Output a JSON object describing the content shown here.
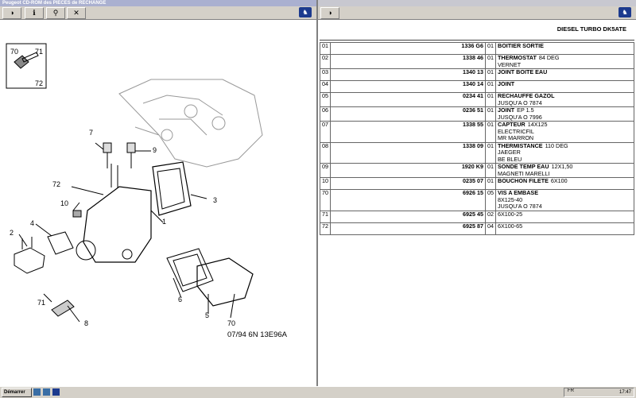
{
  "window": {
    "title": "Peugeot CD-ROM des PIECES de RECHANGE"
  },
  "left_toolbar": {
    "buttons": [
      "◑",
      "ℹ",
      "⚲",
      "✕"
    ]
  },
  "right_toolbar": {
    "buttons": [
      "◑"
    ]
  },
  "diagram": {
    "ref_labels": [
      "70",
      "71",
      "72",
      "7",
      "9",
      "72",
      "10",
      "3",
      "4",
      "1",
      "2",
      "6",
      "71",
      "8",
      "5",
      "70"
    ],
    "code": "07/94  6N  13E96A"
  },
  "parts_list": {
    "title": "DIESEL TURBO DK5ATE",
    "rows": [
      {
        "num": "01",
        "ref": "1336 G6",
        "qty": "01",
        "name": "BOITIER SORTIE",
        "extra": []
      },
      {
        "num": "02",
        "ref": "1338 46",
        "qty": "01",
        "name": "THERMOSTAT",
        "detail": "84 DEG",
        "extra": [
          "VERNET"
        ]
      },
      {
        "num": "03",
        "ref": "1340 13",
        "qty": "01",
        "name": "JOINT BOITE EAU",
        "extra": []
      },
      {
        "num": "04",
        "ref": "1340 14",
        "qty": "01",
        "name": "JOINT",
        "extra": []
      },
      {
        "num": "05",
        "ref": "0234 41",
        "qty": "01",
        "name": "RECHAUFFE GAZOL",
        "extra": [
          "JUSQU'A O 7874"
        ]
      },
      {
        "num": "06",
        "ref": "0236 51",
        "qty": "01",
        "name": "JOINT",
        "detail": "EP 1.5",
        "extra": [
          "JUSQU'A O 7996"
        ]
      },
      {
        "num": "07",
        "ref": "1338 55",
        "qty": "01",
        "name": "CAPTEUR",
        "detail": "14X125",
        "extra": [
          "ELECTRICFIL",
          "MR MARRON"
        ]
      },
      {
        "num": "08",
        "ref": "1338 09",
        "qty": "01",
        "name": "THERMISTANCE",
        "detail": "110 DEG",
        "extra": [
          "JAEGER",
          "BE BLEU"
        ]
      },
      {
        "num": "09",
        "ref": "1920 K9",
        "qty": "01",
        "name": "SONDE TEMP EAU",
        "detail": "12X1,50",
        "extra": [
          "MAGNETI MARELLI"
        ]
      },
      {
        "num": "10",
        "ref": "0235 07",
        "qty": "01",
        "name": "BOUCHON FILETE",
        "detail": "6X100",
        "extra": []
      },
      {
        "num": "70",
        "ref": "6926 15",
        "qty": "05",
        "name": "VIS A EMBASE",
        "extra": [
          "8X125-40",
          "JUSQU'A O 7874"
        ]
      },
      {
        "num": "71",
        "ref": "6925 45",
        "qty": "02",
        "name": "",
        "detail": "6X100-25",
        "extra": []
      },
      {
        "num": "72",
        "ref": "6925 87",
        "qty": "04",
        "name": "",
        "detail": "6X100-65",
        "extra": []
      }
    ]
  },
  "taskbar": {
    "start_label": "Démarrer",
    "lang": "FR",
    "clock": "17:47"
  },
  "colors": {
    "title_bg": "#aab0d0",
    "logo_bg": "#1c3a8e"
  }
}
